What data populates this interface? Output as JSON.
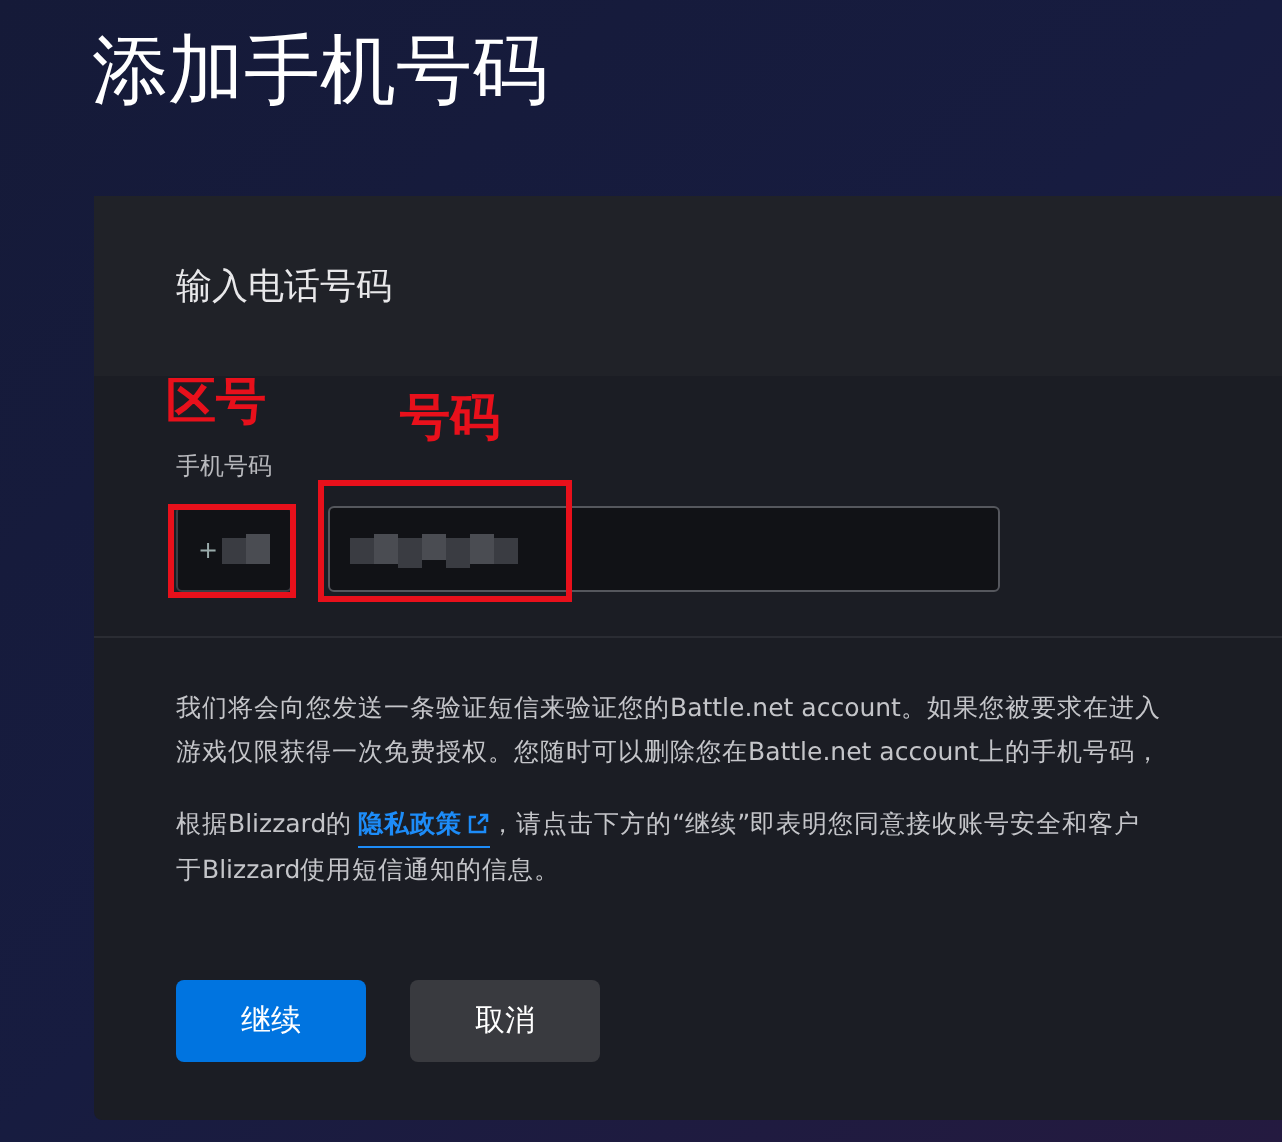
{
  "page_title": "添加手机号码",
  "panel": {
    "heading": "输入电话号码",
    "field_label": "手机号码",
    "area_code": {
      "value": "+",
      "annotation": "区号"
    },
    "phone": {
      "annotation": "号码"
    },
    "paragraph_1": [
      "我们将会向您发送一条验证短信来验证您的Battle.net account。如果您被要求在进入",
      "游戏仅限获得一次免费授权。您随时可以删除您在Battle.net account上的手机号码，"
    ],
    "paragraph_2": {
      "before_link": "根据Blizzard的",
      "link": "隐私政策",
      "after_link": "，请点击下方的“继续”即表明您同意接收账号安全和客户",
      "line_2": "于Blizzard使用短信通知的信息。"
    },
    "buttons": [
      {
        "label": "继续",
        "kind": "primary"
      },
      {
        "label": "取消",
        "kind": "secondary"
      }
    ]
  }
}
